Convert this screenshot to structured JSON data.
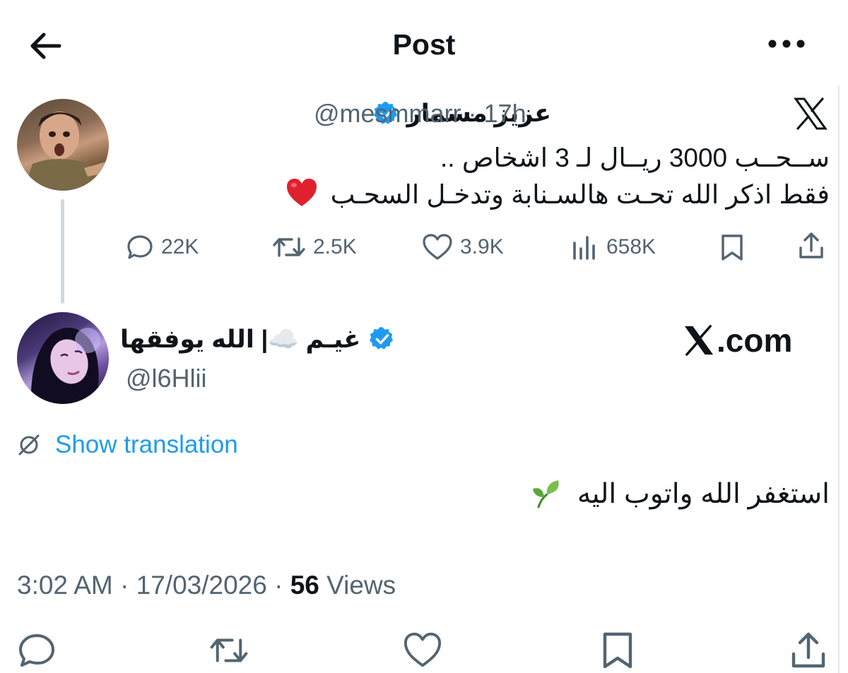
{
  "header": {
    "title": "Post",
    "back_icon": "arrow-left-icon",
    "more_icon": "more-horizontal-icon"
  },
  "quoted_tweet": {
    "display_name": "عزيز مسمار",
    "handle": "@mesmmarr",
    "time": "· 17h",
    "text_line1": "ســحــب 3000 ريــال لـ 3 اشخاص ..",
    "text_line2": "فقط اذكر الله تحـت هالسـنابة وتدخـل السحـب",
    "emoji": "red-heart",
    "stats": {
      "replies": "22K",
      "reposts": "2.5K",
      "likes": "3.9K",
      "views": "658K"
    }
  },
  "reply_tweet": {
    "display_name": "غيـم ☁️| الله يوفقها",
    "handle": "@l6Hlii",
    "watermark": ".com",
    "show_translation": "Show translation",
    "text": "استغفر الله واتوب اليه",
    "emoji": "seedling",
    "timestamp": "3:02 AM · 17/03/2026 ·",
    "views_count": "56",
    "views_label": "Views"
  },
  "colors": {
    "text": "#0f1419",
    "secondary": "#536471",
    "link": "#1d9bf0",
    "verified": "#1d9bf0",
    "heart": "#e0202e"
  }
}
